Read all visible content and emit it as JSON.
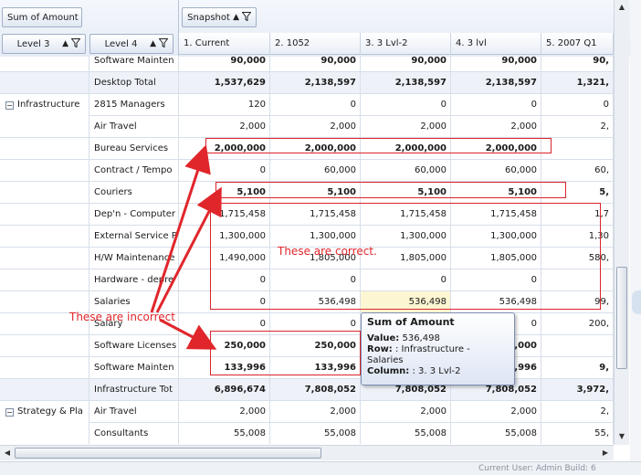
{
  "field_buttons": {
    "data_field": "Sum of Amount",
    "column_field": "Snapshot",
    "row_field_1": "Level 3",
    "row_field_2": "Level 4"
  },
  "column_headers": [
    "1. Current",
    "2. 1052",
    "3. 3 Lvl-2",
    "4. 3 lvl",
    "5. 2007 Q1"
  ],
  "level3_groups": [
    {
      "label": "Infrastructure",
      "row": 2,
      "expander": "−"
    },
    {
      "label": "Strategy & Pla",
      "row": 16,
      "expander": "−"
    }
  ],
  "rows": [
    {
      "l4": "Software Mainten",
      "v": [
        "90,000",
        "90,000",
        "90,000",
        "90,000",
        "90,"
      ],
      "style": "bold"
    },
    {
      "l4": "Desktop Total",
      "v": [
        "1,537,629",
        "2,138,597",
        "2,138,597",
        "2,138,597",
        "1,321,"
      ],
      "style": "total"
    },
    {
      "l4": "2815 Managers",
      "v": [
        "120",
        "0",
        "0",
        "0",
        "0"
      ],
      "style": ""
    },
    {
      "l4": "Air Travel",
      "v": [
        "2,000",
        "2,000",
        "2,000",
        "2,000",
        "2,"
      ],
      "style": ""
    },
    {
      "l4": "Bureau Services",
      "v": [
        "2,000,000",
        "2,000,000",
        "2,000,000",
        "2,000,000",
        ""
      ],
      "style": "bold"
    },
    {
      "l4": "Contract / Tempo",
      "v": [
        "0",
        "60,000",
        "60,000",
        "60,000",
        "60,"
      ],
      "style": ""
    },
    {
      "l4": "Couriers",
      "v": [
        "5,100",
        "5,100",
        "5,100",
        "5,100",
        "5,"
      ],
      "style": "bold"
    },
    {
      "l4": "Dep'n - Computer",
      "v": [
        "1,715,458",
        "1,715,458",
        "1,715,458",
        "1,715,458",
        "1,7"
      ],
      "style": ""
    },
    {
      "l4": "External Service P",
      "v": [
        "1,300,000",
        "1,300,000",
        "1,300,000",
        "1,300,000",
        "1,30"
      ],
      "style": ""
    },
    {
      "l4": "H/W Maintenance",
      "v": [
        "1,490,000",
        "1,805,000",
        "1,805,000",
        "1,805,000",
        "580,"
      ],
      "style": ""
    },
    {
      "l4": "Hardware - depre",
      "v": [
        "0",
        "0",
        "0",
        "0",
        ""
      ],
      "style": ""
    },
    {
      "l4": "Salaries",
      "v": [
        "0",
        "536,498",
        "536,498",
        "536,498",
        "99,"
      ],
      "style": ""
    },
    {
      "l4": "Salary",
      "v": [
        "0",
        "0",
        "0",
        "0",
        "200,"
      ],
      "style": ""
    },
    {
      "l4": "Software Licenses",
      "v": [
        "250,000",
        "250,000",
        "",
        "0,000",
        ""
      ],
      "style": "bold"
    },
    {
      "l4": "Software Mainten",
      "v": [
        "133,996",
        "133,996",
        "",
        "3,996",
        "9,"
      ],
      "style": "bold"
    },
    {
      "l4": "Infrastructure Tot",
      "v": [
        "6,896,674",
        "7,808,052",
        "7,808,052",
        "7,808,052",
        "3,972,"
      ],
      "style": "total"
    },
    {
      "l4": "Air Travel",
      "v": [
        "2,000",
        "2,000",
        "2,000",
        "2,000",
        "2,"
      ],
      "style": ""
    },
    {
      "l4": "Consultants",
      "v": [
        "55,008",
        "55,008",
        "55,008",
        "55,008",
        "55,"
      ],
      "style": ""
    }
  ],
  "annotations": {
    "correct_text": "These are correct.",
    "incorrect_text": "These are incorrect"
  },
  "tooltip": {
    "title": "Sum of Amount",
    "value_label": "Value:",
    "value": "536,498",
    "row_label": "Row:",
    "row": ": Infrastructure - Salaries",
    "column_label": "Column:",
    "column": ": 3. 3 Lvl-2"
  },
  "status_text": "Current User: Admin    Build: 6",
  "icons": {
    "filter": "filter-funnel-icon",
    "sort": "sort-up-icon",
    "expander": "collapse-minus-icon"
  },
  "colors": {
    "annotation_red": "#d9252b",
    "highlight_cell": "#fdf6d2"
  }
}
